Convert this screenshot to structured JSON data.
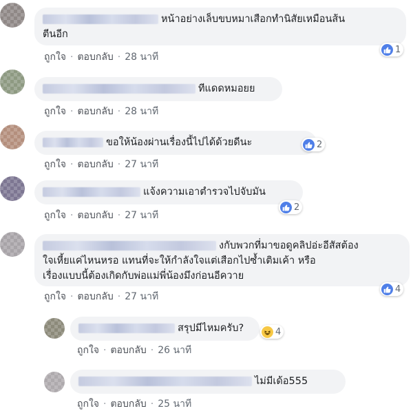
{
  "comments": [
    {
      "text": "หน้าอย่างเล็บขบหมาเสือกทำนิสัยเหมือนส้นตีนอีก",
      "line1": "หน้าอย่างเล็บขบหมาเสือกทำนิสัยเหมือนส้น",
      "line2": "ตีนอีก",
      "like": "ถูกใจ",
      "reply": "ตอบกลับ",
      "time": "28 นาที",
      "reaction_count": "1"
    },
    {
      "text": "ทีแดดหมอยย",
      "like": "ถูกใจ",
      "reply": "ตอบกลับ",
      "time": "28 นาที"
    },
    {
      "text": "ขอให้น้องผ่านเรื่องนี้ไปได้ด้วยดีนะ",
      "like": "ถูกใจ",
      "reply": "ตอบกลับ",
      "time": "27 นาที",
      "reaction_count": "2"
    },
    {
      "text": "แจ้งความเอาตำรวจไปจับมัน",
      "like": "ถูกใจ",
      "reply": "ตอบกลับ",
      "time": "27 นาที",
      "reaction_count": "2"
    },
    {
      "line1": "งกับพวกที่มาขอดูคลิปอ่ะอีสัสต้อง",
      "line2": "ใจเหี้ยแค่ไหนหรอ แทนที่จะให้กำลังใจแต่เสือกไปซ้ำเติมเค้า หรือ",
      "line3": "เรื่องแบบนี้ต้องเกิดกับพ่อแม่พี่น้องมึงก่อนอีควาย",
      "like": "ถูกใจ",
      "reply": "ตอบกลับ",
      "time": "27 นาที",
      "reaction_count": "4"
    }
  ],
  "replies": [
    {
      "text": "สรุปมีไหมครับ?",
      "like": "ถูกใจ",
      "reply": "ตอบกลับ",
      "time": "26 นาที",
      "reaction_count": "4"
    },
    {
      "text": "ไม่มีเด้อ555",
      "like": "ถูกใจ",
      "reply": "ตอบกลับ",
      "time": "25 นาที"
    }
  ],
  "colors": {
    "like_blue": "#4f7fe8",
    "haha_yellow": "#f7c845",
    "bubble_bg": "#f2f3f5"
  },
  "icons": {
    "like": "like-icon",
    "haha": "haha-icon"
  }
}
